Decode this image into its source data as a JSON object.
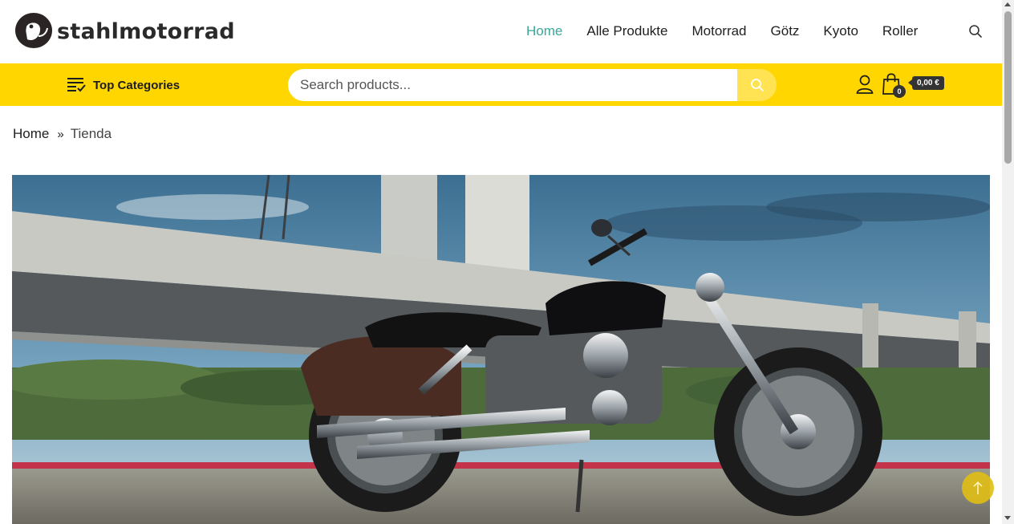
{
  "brand": {
    "name": "stahlmotorrad"
  },
  "nav": {
    "items": [
      {
        "label": "Home",
        "active": true
      },
      {
        "label": "Alle Produkte",
        "active": false
      },
      {
        "label": "Motorrad",
        "active": false
      },
      {
        "label": "Götz",
        "active": false
      },
      {
        "label": "Kyoto",
        "active": false
      },
      {
        "label": "Roller",
        "active": false
      }
    ],
    "search_icon": "search-icon"
  },
  "toolbar": {
    "top_categories_label": "Top Categories",
    "top_categories_icon": "list-check-icon",
    "search_placeholder": "Search products...",
    "search_button_icon": "search-icon",
    "user_icon": "user-icon",
    "cart_icon": "shopping-bag-icon",
    "cart_count": "0",
    "cart_total": "0,00 €"
  },
  "breadcrumb": {
    "home": "Home",
    "separator_icon": "double-chevron-right-icon",
    "current": "Tienda"
  },
  "hero": {
    "image": "black cruiser motorcycle parked under a concrete bridge"
  },
  "back_to_top_icon": "arrow-up-icon",
  "colors": {
    "accent_yellow": "#ffd600",
    "active_nav": "#3aa89a",
    "text_dark": "#1f1f1f",
    "badge_dark": "#333333"
  }
}
